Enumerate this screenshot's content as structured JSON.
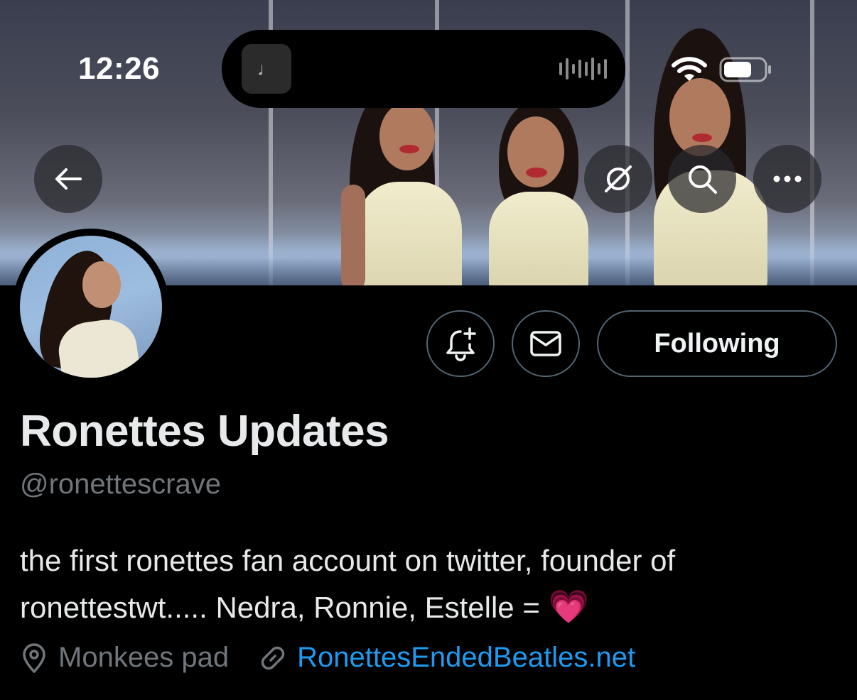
{
  "status_bar": {
    "time": "12:26",
    "now_playing_icon": "music-note-icon",
    "waveform_icon": "waveform-icon",
    "wifi_icon": "wifi-icon",
    "battery_icon": "battery-icon"
  },
  "header_controls": {
    "back_icon": "arrow-left-icon",
    "grok_icon": "grok-icon",
    "search_icon": "search-icon",
    "more_icon": "more-icon"
  },
  "actions": {
    "notify_icon": "bell-plus-icon",
    "message_icon": "envelope-icon",
    "following_label": "Following"
  },
  "profile": {
    "display_name": "Ronettes Updates",
    "handle": "@ronettescrave",
    "bio_line1": "the first ronettes fan account on twitter, founder of",
    "bio_line2": "ronettestwt..... Nedra, Ronnie, Estelle = ",
    "bio_emoji": "💗",
    "location": "Monkees pad",
    "website": "RonettesEndedBeatles.net"
  },
  "colors": {
    "background": "#000000",
    "text_primary": "#e7e9ea",
    "text_secondary": "#71767b",
    "link": "#1d9bf0",
    "button_border": "#536471"
  }
}
